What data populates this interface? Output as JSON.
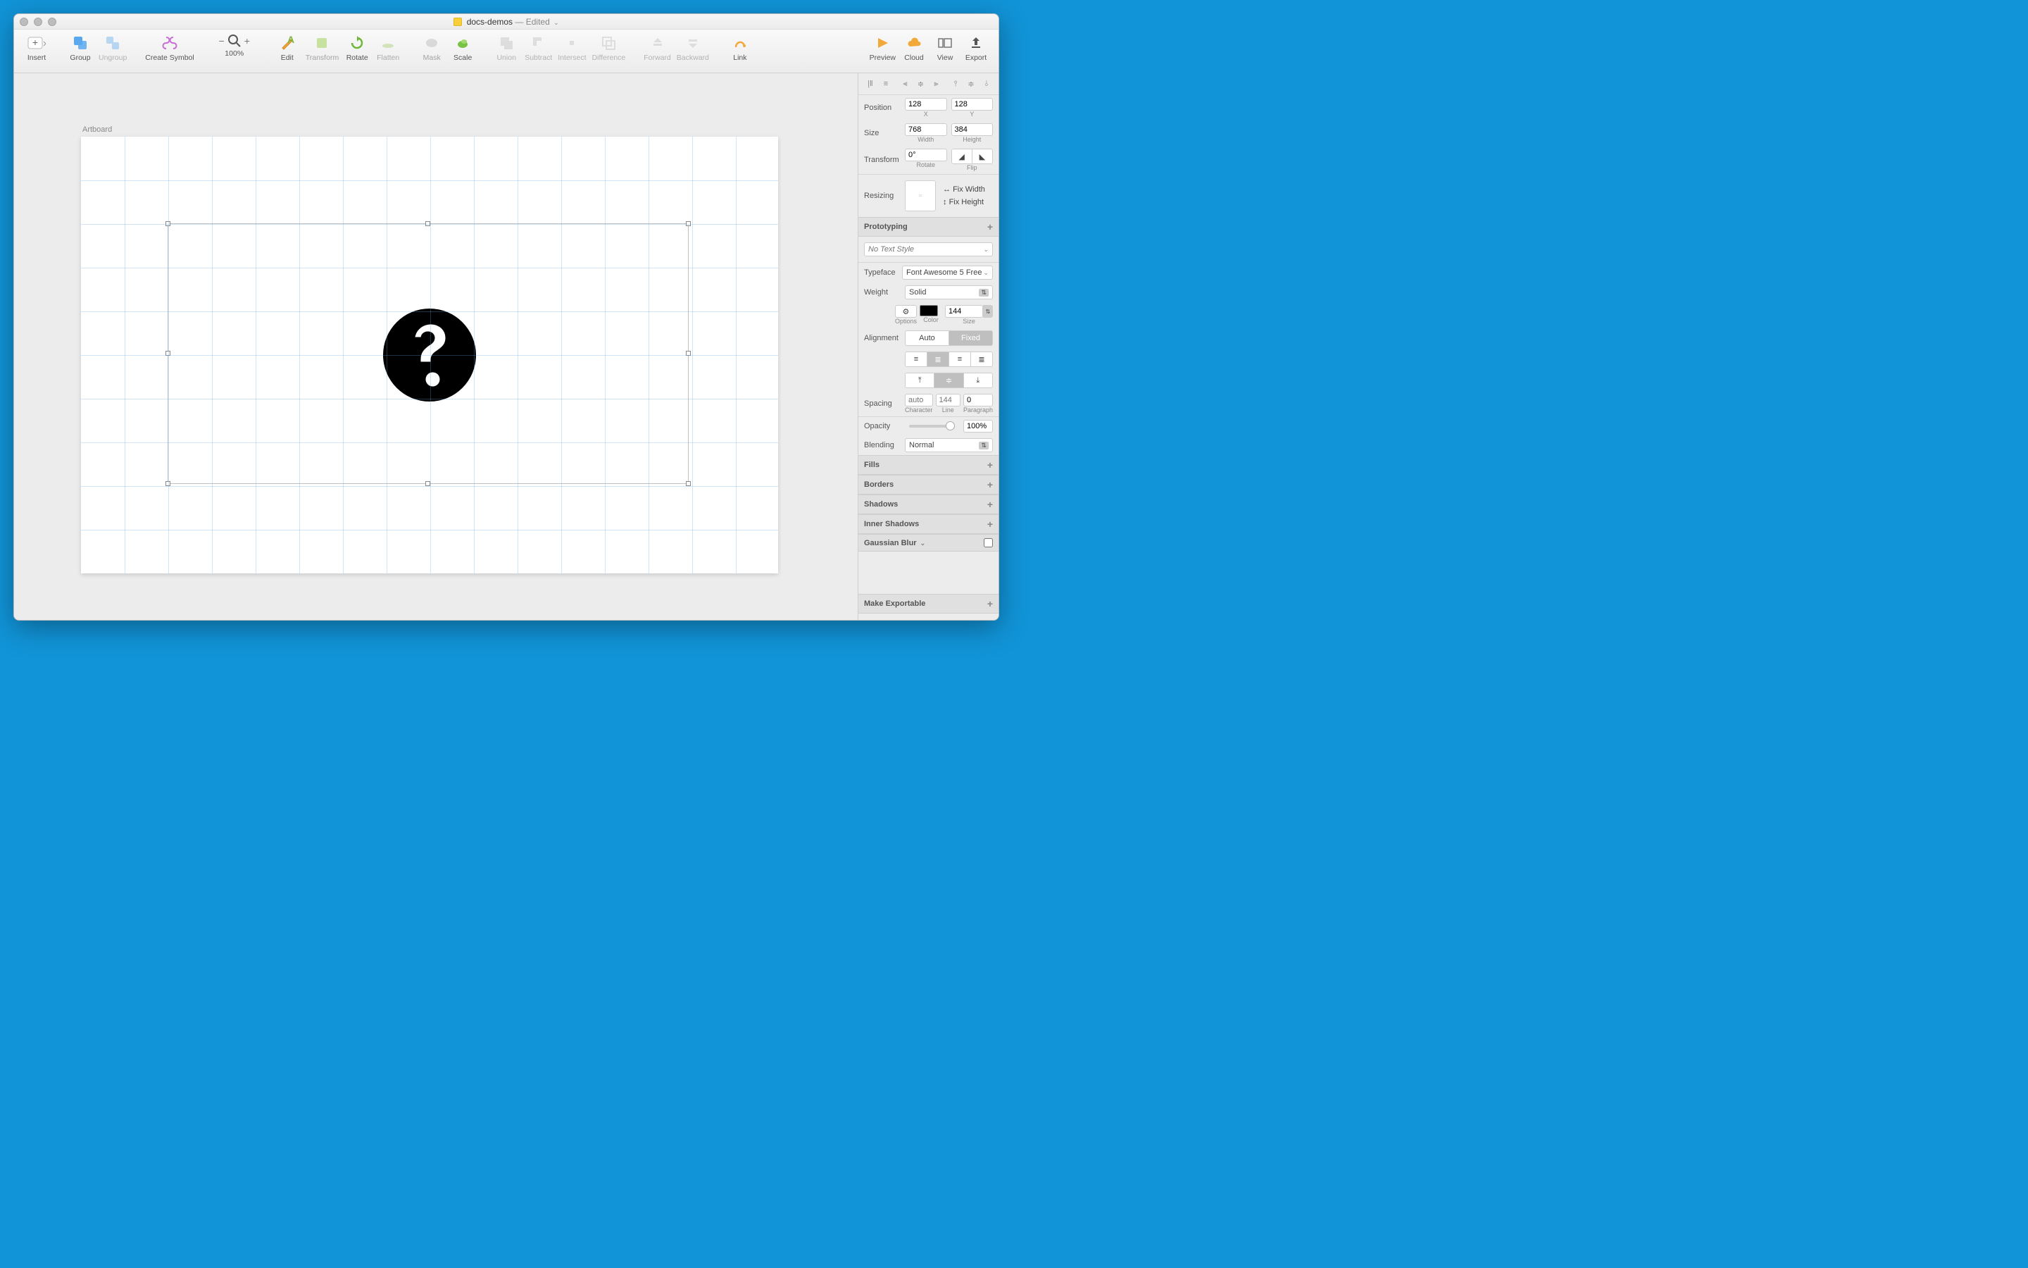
{
  "title": {
    "doc": "docs-demos",
    "state": "— Edited"
  },
  "toolbar": {
    "insert": "Insert",
    "group": "Group",
    "ungroup": "Ungroup",
    "createSymbol": "Create Symbol",
    "zoom": "100%",
    "edit": "Edit",
    "transform": "Transform",
    "rotate": "Rotate",
    "flatten": "Flatten",
    "mask": "Mask",
    "scale": "Scale",
    "union": "Union",
    "subtract": "Subtract",
    "intersect": "Intersect",
    "difference": "Difference",
    "forward": "Forward",
    "backward": "Backward",
    "link": "Link",
    "preview": "Preview",
    "cloud": "Cloud",
    "view": "View",
    "export": "Export"
  },
  "canvas": {
    "artboardLabel": "Artboard"
  },
  "inspector": {
    "position": "Position",
    "posX": "128",
    "posY": "128",
    "xLbl": "X",
    "yLbl": "Y",
    "size": "Size",
    "width": "768",
    "height": "384",
    "wLbl": "Width",
    "hLbl": "Height",
    "transform": "Transform",
    "rotate": "0°",
    "rotLbl": "Rotate",
    "flipLbl": "Flip",
    "resizing": "Resizing",
    "fixWidth": "Fix Width",
    "fixHeight": "Fix Height",
    "prototyping": "Prototyping",
    "noTextStyle": "No Text Style",
    "typeface": "Typeface",
    "typefaceVal": "Font Awesome 5 Free",
    "weight": "Weight",
    "weightVal": "Solid",
    "options": "Options",
    "color": "Color",
    "sizeLbl": "Size",
    "sizeVal": "144",
    "alignment": "Alignment",
    "auto": "Auto",
    "fixed": "Fixed",
    "spacing": "Spacing",
    "character": "Character",
    "line": "Line",
    "paragraph": "Paragraph",
    "spacingChar": "auto",
    "spacingLine": "144",
    "spacingPara": "0",
    "opacity": "Opacity",
    "opacityVal": "100%",
    "blending": "Blending",
    "blendingVal": "Normal",
    "fills": "Fills",
    "borders": "Borders",
    "shadows": "Shadows",
    "innerShadows": "Inner Shadows",
    "gaussianBlur": "Gaussian Blur",
    "makeExportable": "Make Exportable"
  }
}
